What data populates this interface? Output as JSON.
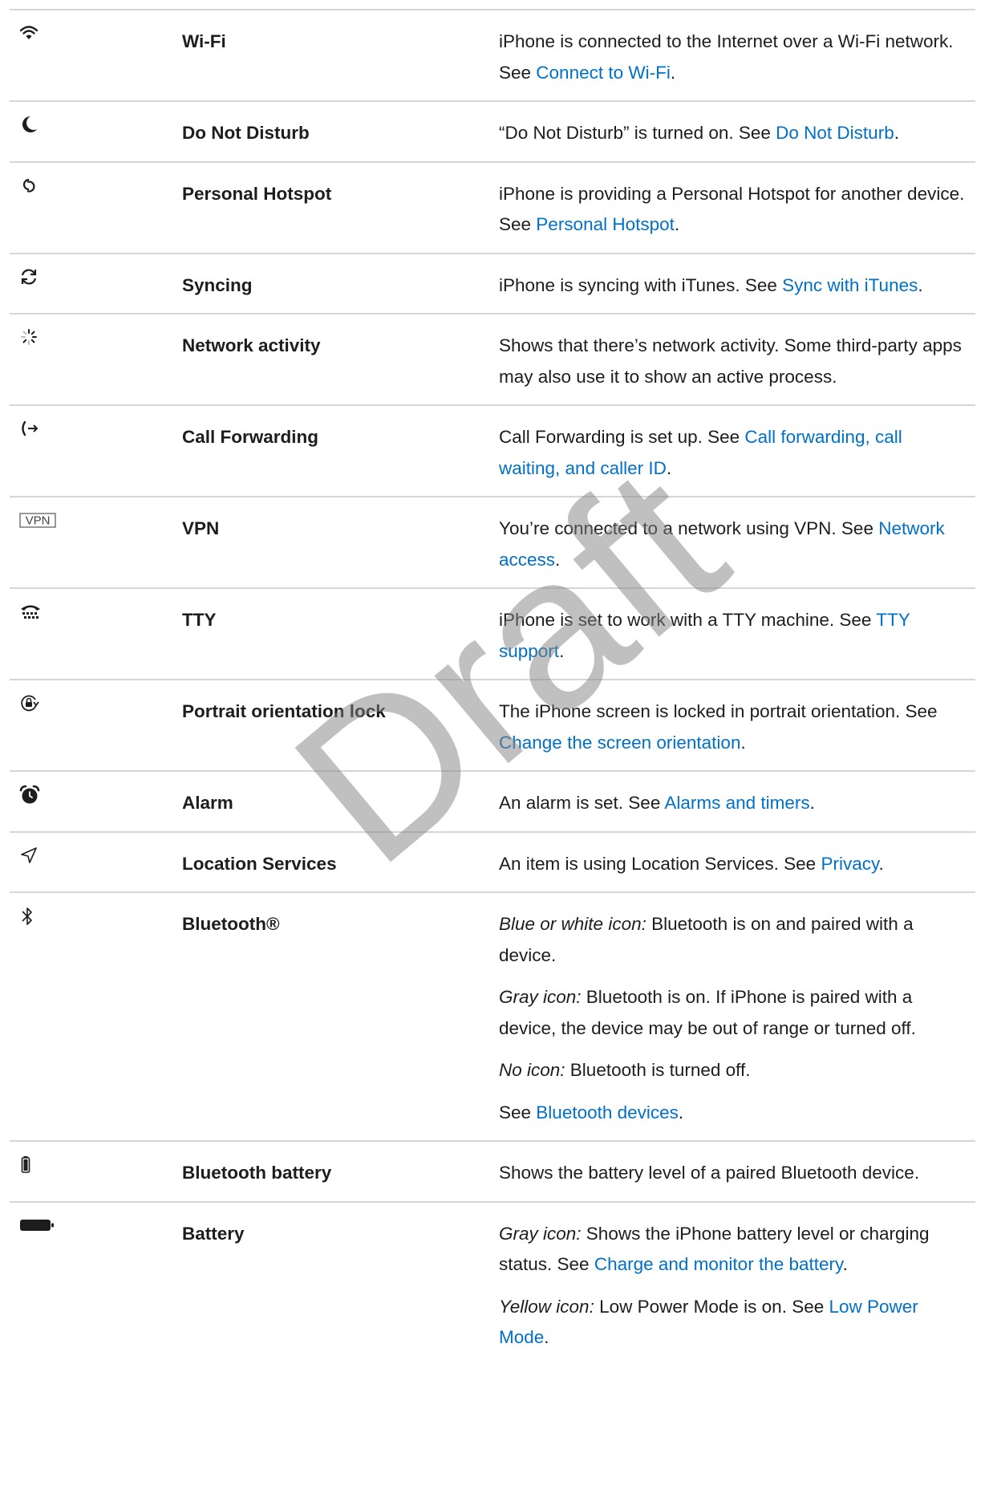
{
  "watermark": "Draft",
  "colors": {
    "link": "#0070c9",
    "text": "#1d1d1f",
    "divider": "#d6d6d6"
  },
  "rows": [
    {
      "icon": "wifi-icon",
      "name": "Wi-Fi",
      "p1": {
        "a": "iPhone is connected to the Internet over a Wi-Fi network. See ",
        "link": "Connect to Wi-Fi",
        "b": "."
      }
    },
    {
      "icon": "moon-icon",
      "name": "Do Not Disturb",
      "p1": {
        "a": "“Do Not Disturb” is turned on. See ",
        "link": "Do Not Disturb",
        "b": "."
      }
    },
    {
      "icon": "hotspot-icon",
      "name": "Personal Hotspot",
      "p1": {
        "a": "iPhone is providing a Personal Hotspot for another device. See ",
        "link": "Personal Hotspot",
        "b": "."
      }
    },
    {
      "icon": "sync-icon",
      "name": "Syncing",
      "p1": {
        "a": "iPhone is syncing with iTunes. See ",
        "link": "Sync with iTunes",
        "b": "."
      }
    },
    {
      "icon": "network-activity-icon",
      "name": "Network activity",
      "p1": {
        "a": "Shows that there’s network activity. Some third-party apps may also use it to show an active process."
      }
    },
    {
      "icon": "call-forwarding-icon",
      "name": "Call Forwarding",
      "p1": {
        "a": "Call Forwarding is set up. See ",
        "link": "Call forwarding, call waiting, and caller ID",
        "b": "."
      }
    },
    {
      "icon": "vpn-icon",
      "icon_text": "VPN",
      "name": "VPN",
      "p1": {
        "a": "You’re connected to a network using VPN. See ",
        "link": "Network access",
        "b": "."
      }
    },
    {
      "icon": "tty-icon",
      "name": "TTY",
      "p1": {
        "a": "iPhone is set to work with a TTY machine. See ",
        "link": "TTY support",
        "b": "."
      }
    },
    {
      "icon": "orientation-lock-icon",
      "name": "Portrait orientation lock",
      "p1": {
        "a": "The iPhone screen is locked in portrait orientation. See ",
        "link": "Change the screen orientation",
        "b": "."
      }
    },
    {
      "icon": "alarm-icon",
      "name": "Alarm",
      "p1": {
        "a": "An alarm is set. See ",
        "link": "Alarms and timers",
        "b": "."
      }
    },
    {
      "icon": "location-icon",
      "name": "Location Services",
      "p1": {
        "a": "An item is using Location Services. See ",
        "link": "Privacy",
        "b": "."
      }
    },
    {
      "icon": "bluetooth-icon",
      "name": "Bluetooth®",
      "p1": {
        "em": "Blue or white icon:",
        "a": " Bluetooth is on and paired with a device."
      },
      "p2": {
        "em": "Gray icon:",
        "a": " Bluetooth is on. If iPhone is paired with a device, the device may be out of range or turned off."
      },
      "p3": {
        "em": "No icon:",
        "a": " Bluetooth is turned off."
      },
      "p4": {
        "a": "See ",
        "link": "Bluetooth devices",
        "b": "."
      }
    },
    {
      "icon": "bluetooth-battery-icon",
      "name": "Bluetooth battery",
      "p1": {
        "a": "Shows the battery level of a paired Bluetooth device."
      }
    },
    {
      "icon": "battery-icon",
      "name": "Battery",
      "p1": {
        "em": "Gray icon:",
        "a": " Shows the iPhone battery level or charging status. See ",
        "link": "Charge and monitor the battery",
        "b": "."
      },
      "p2": {
        "em": "Yellow icon:",
        "a": " Low Power Mode is on. See ",
        "link": "Low Power Mode",
        "b": "."
      }
    }
  ]
}
